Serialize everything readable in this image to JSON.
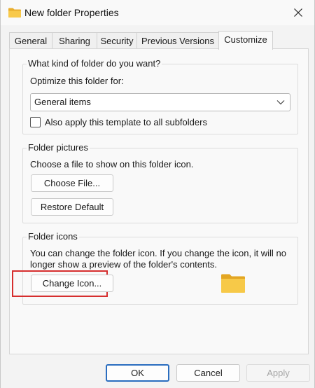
{
  "window": {
    "title": "New folder Properties"
  },
  "icons": {
    "title": "folder-icon",
    "close": "close-icon",
    "dropdown": "chevron-down-icon",
    "folder_preview": "folder-icon"
  },
  "tabs": [
    {
      "label": "General"
    },
    {
      "label": "Sharing"
    },
    {
      "label": "Security"
    },
    {
      "label": "Previous Versions"
    },
    {
      "label": "Customize",
      "active": true
    }
  ],
  "folder_type": {
    "heading": "What kind of folder do you want?",
    "optimize_label": "Optimize this folder for:",
    "selected": "General items",
    "subfolders_checkbox_label": "Also apply this template to all subfolders",
    "subfolders_checked": false
  },
  "folder_pictures": {
    "heading": "Folder pictures",
    "description": "Choose a file to show on this folder icon.",
    "choose_file_label": "Choose File...",
    "restore_default_label": "Restore Default"
  },
  "folder_icons": {
    "heading": "Folder icons",
    "description_line1": "You can change the folder icon. If you change the icon, it will no",
    "description_line2": "longer show a preview of the folder's contents.",
    "change_icon_label": "Change Icon..."
  },
  "footer": {
    "ok_label": "OK",
    "cancel_label": "Cancel",
    "apply_label": "Apply"
  },
  "colors": {
    "accent": "#2a6dbf",
    "highlight": "#d62e2e",
    "folder": "#f6c344"
  }
}
